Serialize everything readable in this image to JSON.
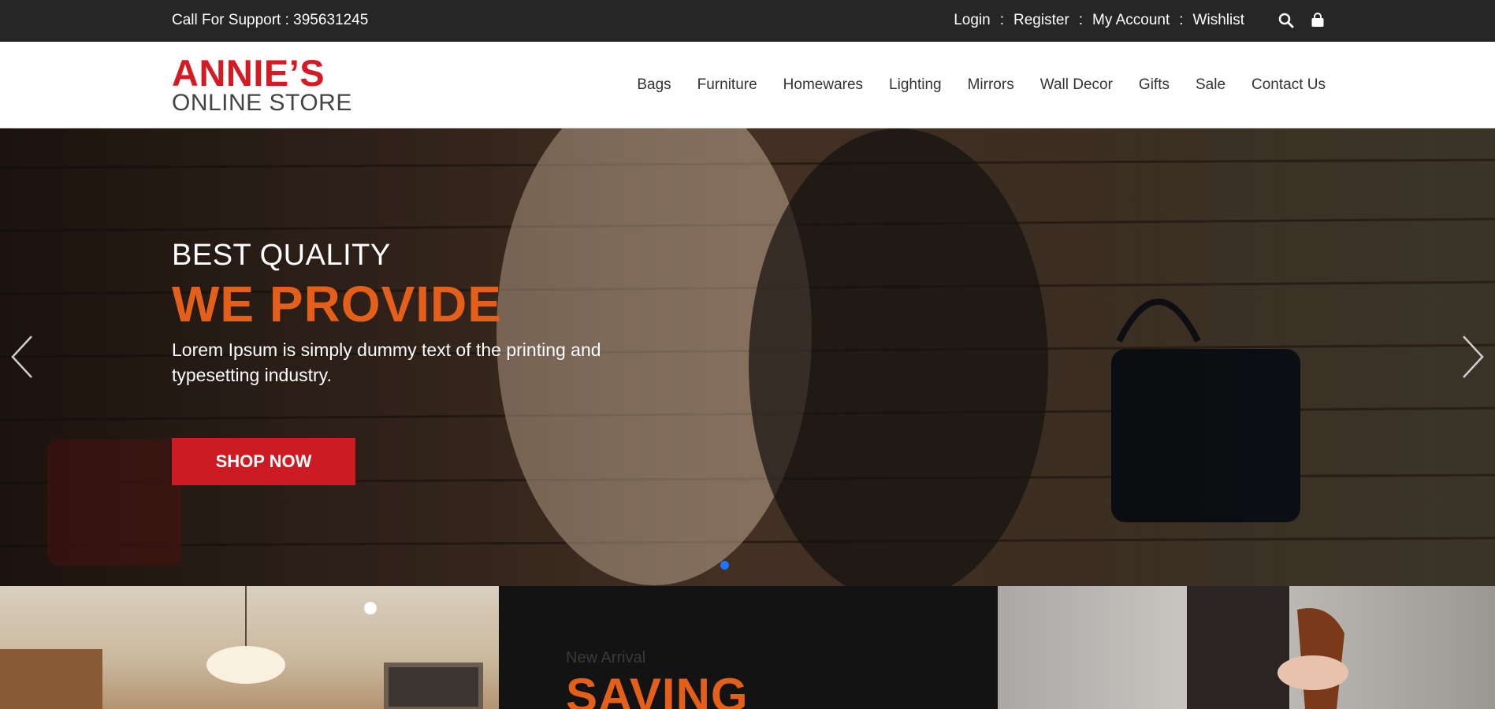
{
  "topbar": {
    "support_text": "Call For Support : 395631245",
    "links": [
      "Login",
      "Register",
      "My Account",
      "Wishlist"
    ],
    "separator": ":",
    "icons": [
      "search-icon",
      "shopping-bag-icon"
    ]
  },
  "header": {
    "logo_line1": "ANNIE’S",
    "logo_line2": "ONLINE STORE",
    "nav": [
      "Bags",
      "Furniture",
      "Homewares",
      "Lighting",
      "Mirrors",
      "Wall Decor",
      "Gifts",
      "Sale",
      "Contact Us"
    ]
  },
  "hero": {
    "kicker": "BEST QUALITY",
    "headline": "WE PROVIDE",
    "description": "Lorem Ipsum is simply dummy text of the printing and typesetting industry.",
    "cta": "SHOP NOW",
    "colors": {
      "headline": "#e35f1a",
      "cta_bg": "#cc1b22",
      "active_dot": "#1e73ff"
    }
  },
  "tiles": {
    "middle_small": "New Arrival",
    "middle_big": "SAVING"
  }
}
